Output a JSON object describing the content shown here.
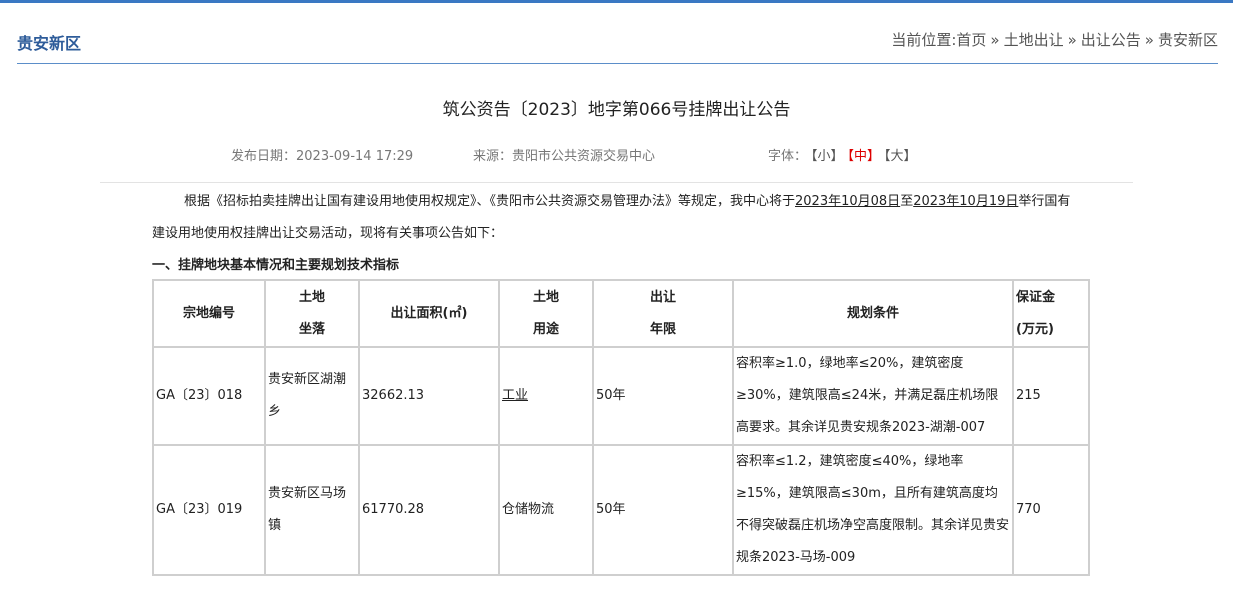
{
  "header": {
    "section_title": "贵安新区",
    "breadcrumb_prefix": "当前位置:",
    "breadcrumb": [
      "首页",
      "土地出让",
      "出让公告",
      "贵安新区"
    ],
    "separator": "»"
  },
  "article": {
    "title": "筑公资告〔2023〕地字第066号挂牌出让公告",
    "publish_label": "发布日期：",
    "publish_date": "2023-09-14 17:29",
    "source_label": "来源：",
    "source": "贵阳市公共资源交易中心",
    "font_label": "字体：",
    "font_small": "【小】",
    "font_medium": "【中】",
    "font_large": "【大】",
    "para_part1": "根据《招标拍卖挂牌出让国有建设用地使用权规定》、《贵阳市公共资源交易管理办法》等规定，我中心将于",
    "date_start": "2023年10月08日",
    "para_part2": "至",
    "date_end": "2023年10月19日",
    "para_part3": "举行国有建设用地使用权挂牌出让交易活动，现将有关事项公告如下：",
    "section1_heading": "一、挂牌地块基本情况和主要规划技术指标"
  },
  "table": {
    "headers": {
      "id": "宗地编号",
      "location_l1": "土地",
      "location_l2": "坐落",
      "area": "出让面积(㎡)",
      "use_l1": "土地",
      "use_l2": "用途",
      "term_l1": "出让",
      "term_l2": "年限",
      "planning": "规划条件",
      "deposit_l1": "保证金",
      "deposit_l2": "(万元)"
    },
    "rows": [
      {
        "id": "GA〔23〕018",
        "location": "贵安新区湖潮乡",
        "area": "32662.13",
        "use": "工业",
        "term": "50年",
        "planning": "容积率≥1.0，绿地率≤20%，建筑密度≥30%，建筑限高≤24米，并满足磊庄机场限高要求。其余详见贵安规条2023-湖潮-007",
        "deposit": "215"
      },
      {
        "id": "GA〔23〕019",
        "location": "贵安新区马场镇",
        "area": "61770.28",
        "use": "仓储物流",
        "term": "50年",
        "planning": "容积率≤1.2，建筑密度≤40%，绿地率≥15%，建筑限高≤30m，且所有建筑高度均不得突破磊庄机场净空高度限制。其余详见贵安规条2023-马场-009",
        "deposit": "770"
      }
    ]
  }
}
